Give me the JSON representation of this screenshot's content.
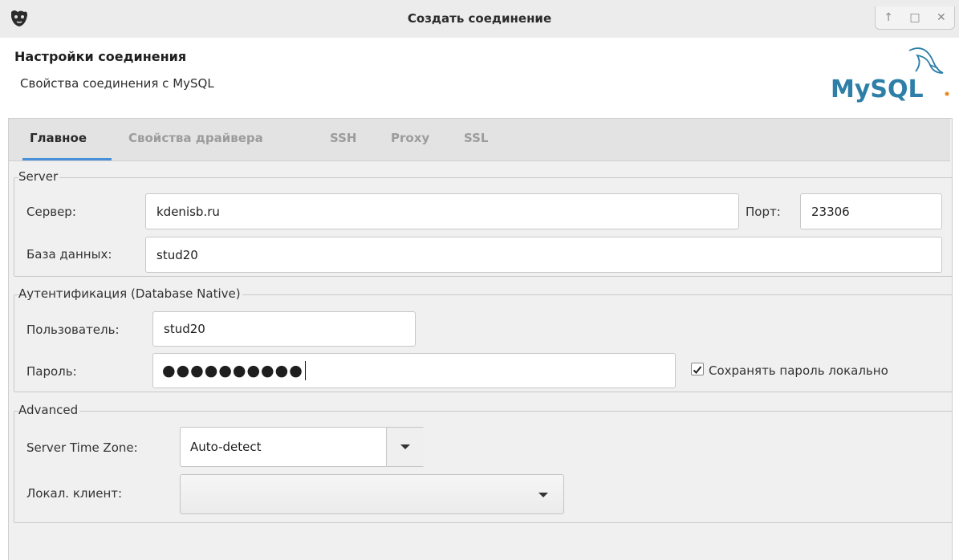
{
  "window": {
    "title": "Создать соединение",
    "controls": [
      "↑",
      "□",
      "✕"
    ]
  },
  "header": {
    "title": "Настройки соединения",
    "subtitle": "Свойства соединения с MySQL",
    "logo_text": "MySQL"
  },
  "tabs": [
    {
      "label": "Главное",
      "active": true
    },
    {
      "label": "Свойства драйвера",
      "active": false
    },
    {
      "label": "SSH",
      "active": false
    },
    {
      "label": "Proxy",
      "active": false
    },
    {
      "label": "SSL",
      "active": false
    }
  ],
  "server": {
    "legend": "Server",
    "host_label": "Сервер:",
    "host_value": "kdenisb.ru",
    "port_label": "Порт:",
    "port_value": "23306",
    "database_label": "База данных:",
    "database_value": "stud20"
  },
  "auth": {
    "legend": "Аутентификация (Database Native)",
    "user_label": "Пользователь:",
    "user_value": "stud20",
    "password_label": "Пароль:",
    "password_display": "●●●●●●●●●●",
    "save_password_label": "Сохранять пароль локально",
    "save_password_checked": true
  },
  "advanced": {
    "legend": "Advanced",
    "timezone_label": "Server Time Zone:",
    "timezone_value": "Auto-detect",
    "local_client_label": "Локал. клиент:",
    "local_client_value": ""
  },
  "colors": {
    "accent": "#4a90d9",
    "mysql_blue": "#2d7fa8",
    "mysql_orange": "#e8891c"
  }
}
